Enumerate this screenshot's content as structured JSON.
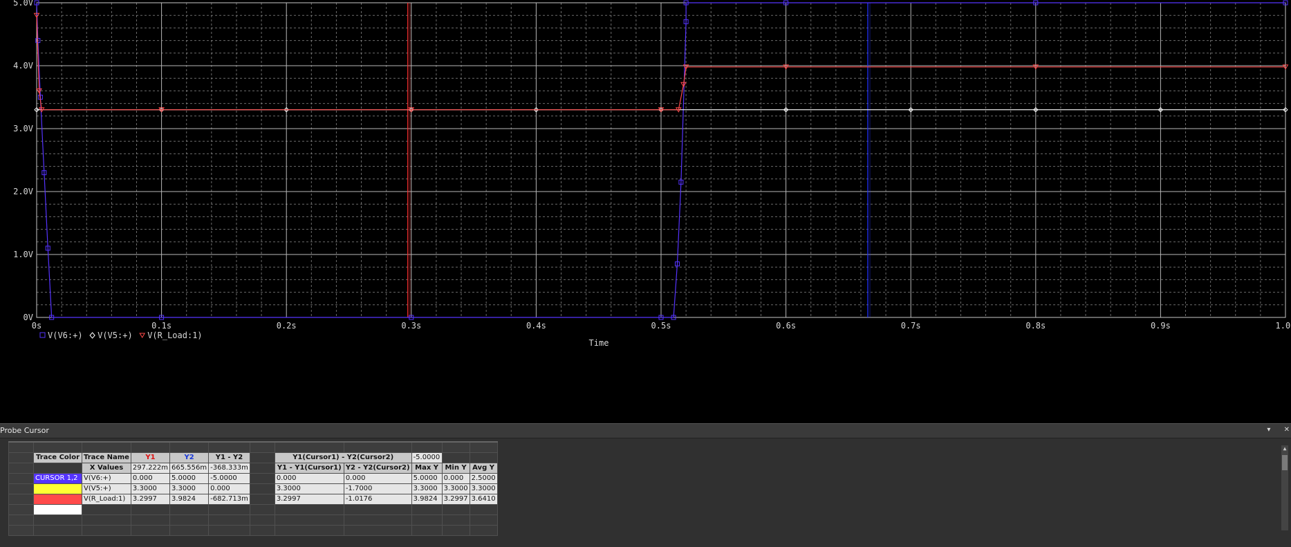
{
  "panel": {
    "title": "Probe Cursor",
    "minimize_label": "▾",
    "close_label": "✕"
  },
  "chart_data": {
    "type": "line",
    "xlabel": "Time",
    "ylabel": "",
    "title": "",
    "xlim": [
      0,
      1.0
    ],
    "ylim": [
      0,
      5.0
    ],
    "x_ticks": [
      0,
      0.1,
      0.2,
      0.3,
      0.4,
      0.5,
      0.6,
      0.7,
      0.8,
      0.9,
      1.0
    ],
    "x_tick_labels": [
      "0s",
      "0.1s",
      "0.2s",
      "0.3s",
      "0.4s",
      "0.5s",
      "0.6s",
      "0.7s",
      "0.8s",
      "0.9s",
      "1.0s"
    ],
    "y_ticks": [
      0,
      1,
      2,
      3,
      4,
      5
    ],
    "y_tick_labels": [
      "0V",
      "1.0V",
      "2.0V",
      "3.0V",
      "4.0V",
      "5.0V"
    ],
    "grid": true,
    "legend_placement": "bottom-left",
    "cursors": [
      {
        "name": "Cursor1",
        "x": 0.297222,
        "color": "#ff3030"
      },
      {
        "name": "Cursor2",
        "x": 0.665556,
        "color": "#2030ff"
      }
    ],
    "series": [
      {
        "name": "V(V6:+)",
        "marker": "square",
        "color": "#5533ff",
        "x": [
          0,
          0.001,
          0.003,
          0.006,
          0.009,
          0.012,
          0.1,
          0.3,
          0.5,
          0.51,
          0.513,
          0.516,
          0.52,
          0.52,
          0.6,
          0.8,
          1.0
        ],
        "y": [
          5.0,
          4.4,
          3.5,
          2.3,
          1.1,
          0.0,
          0.0,
          0.0,
          0.0,
          0.0,
          0.85,
          2.15,
          4.7,
          5.0,
          5.0,
          5.0,
          5.0
        ]
      },
      {
        "name": "V(V5:+)",
        "marker": "diamond",
        "color": "#ffffff",
        "x": [
          0,
          0.1,
          0.2,
          0.3,
          0.4,
          0.5,
          0.6,
          0.7,
          0.8,
          0.9,
          1.0
        ],
        "y": [
          3.3,
          3.3,
          3.3,
          3.3,
          3.3,
          3.3,
          3.3,
          3.3,
          3.3,
          3.3,
          3.3
        ]
      },
      {
        "name": "V(R_Load:1)",
        "marker": "triangle-down",
        "color": "#ff4a4a",
        "x": [
          0,
          0.002,
          0.004,
          0.1,
          0.3,
          0.5,
          0.514,
          0.518,
          0.52,
          0.6,
          0.8,
          1.0
        ],
        "y": [
          4.8,
          3.6,
          3.3,
          3.3,
          3.3,
          3.3,
          3.3,
          3.7,
          3.98,
          3.98,
          3.98,
          3.98
        ]
      }
    ]
  },
  "table": {
    "scalar_y1y2_header": "Y1(Cursor1) - Y2(Cursor2)",
    "scalar_y1y2_value": "-5.0000",
    "header_row": [
      "Trace Color",
      "Trace Name",
      "Y1",
      "Y2",
      "Y1 - Y2"
    ],
    "sub_header_row": [
      "",
      "X Values",
      "297.222m",
      "665.556m",
      "-368.333m"
    ],
    "right_header_row": [
      "Y1 - Y1(Cursor1)",
      "Y2 - Y2(Cursor2)",
      "Max Y",
      "Min Y",
      "Avg Y"
    ],
    "rows": [
      {
        "color_label": "CURSOR 1,2",
        "color": "#5533ff",
        "name": "V(V6:+)",
        "y1": "0.000",
        "y2": "5.0000",
        "diff": "-5.0000",
        "d1": "0.000",
        "d2": "0.000",
        "max": "5.0000",
        "min": "0.000",
        "avg": "2.5000"
      },
      {
        "color_label": "",
        "color": "#ffff33",
        "name": "V(V5:+)",
        "y1": "3.3000",
        "y2": "3.3000",
        "diff": "0.000",
        "d1": "3.3000",
        "d2": "-1.7000",
        "max": "3.3000",
        "min": "3.3000",
        "avg": "3.3000"
      },
      {
        "color_label": "",
        "color": "#ff4a4a",
        "name": "V(R_Load:1)",
        "y1": "3.2997",
        "y2": "3.9824",
        "diff": "-682.713m",
        "d1": "3.2997",
        "d2": "-1.0176",
        "max": "3.9824",
        "min": "3.2997",
        "avg": "3.6410"
      },
      {
        "color_label": "",
        "color": "#ffffff",
        "name": "",
        "y1": "",
        "y2": "",
        "diff": "",
        "d1": "",
        "d2": "",
        "max": "",
        "min": "",
        "avg": ""
      }
    ]
  }
}
